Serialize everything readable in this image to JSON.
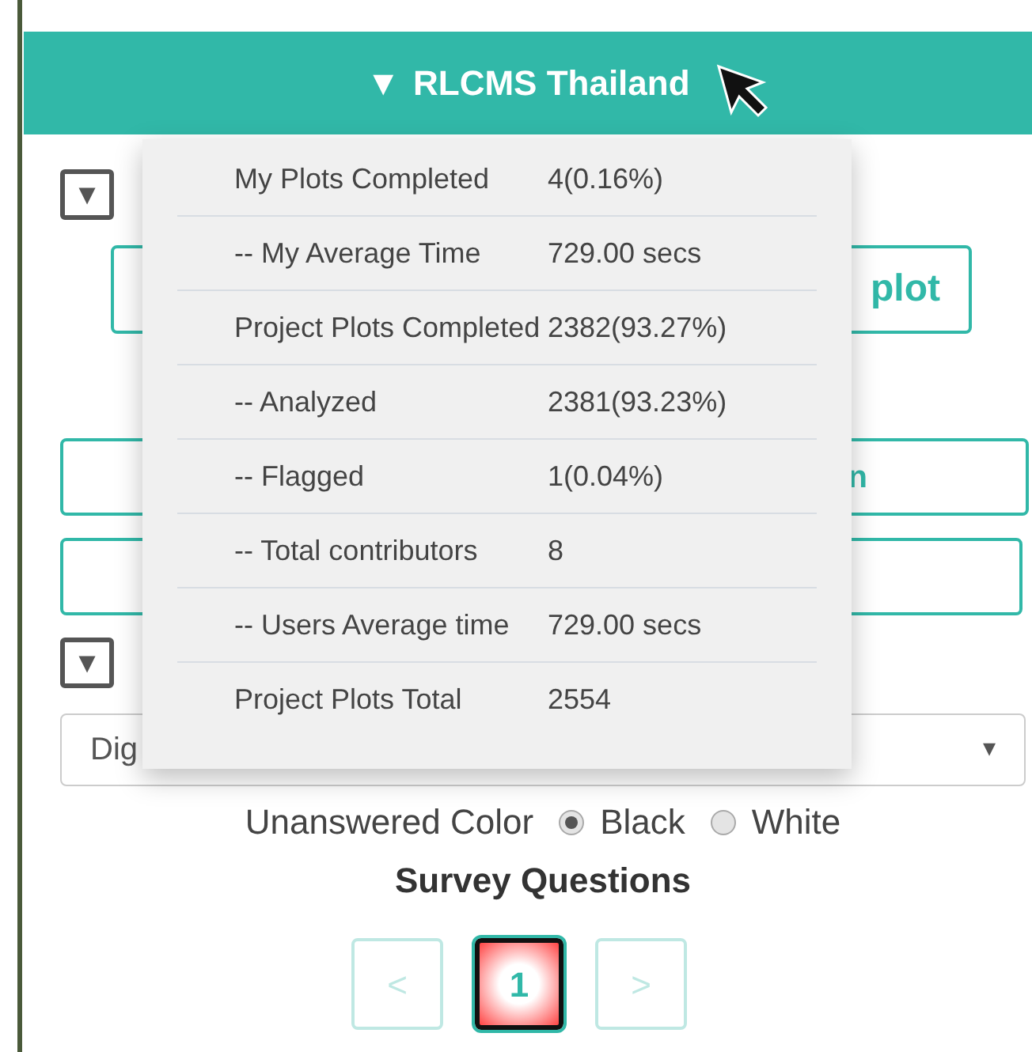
{
  "header": {
    "caret": "▼",
    "title": "RLCMS Thailand"
  },
  "stats_popup": {
    "rows": [
      {
        "label": "My Plots Completed",
        "value": "4(0.16%)"
      },
      {
        "label": "-- My Average Time",
        "value": "729.00 secs"
      },
      {
        "label": "Project Plots Completed",
        "value": "2382(93.27%)"
      },
      {
        "label": "-- Analyzed",
        "value": "2381(93.23%)"
      },
      {
        "label": "-- Flagged",
        "value": "1(0.04%)"
      },
      {
        "label": "-- Total contributors",
        "value": "8"
      },
      {
        "label": "-- Users Average time",
        "value": "729.00 secs"
      },
      {
        "label": "Project Plots Total",
        "value": "2554"
      }
    ]
  },
  "toggles": [
    "▼",
    "▼"
  ],
  "buttons": [
    {
      "label": "plot"
    },
    {
      "label": "n"
    }
  ],
  "imagery_select": {
    "value": "Dig",
    "arrow": "▾"
  },
  "unanswered_color": {
    "label": "Unanswered Color",
    "options": [
      {
        "label": "Black",
        "selected": true
      },
      {
        "label": "White",
        "selected": false
      }
    ]
  },
  "survey_title": "Survey Questions",
  "pagination": {
    "prev": "<",
    "pages": [
      {
        "label": "1",
        "selected": true
      }
    ],
    "next": ">"
  }
}
